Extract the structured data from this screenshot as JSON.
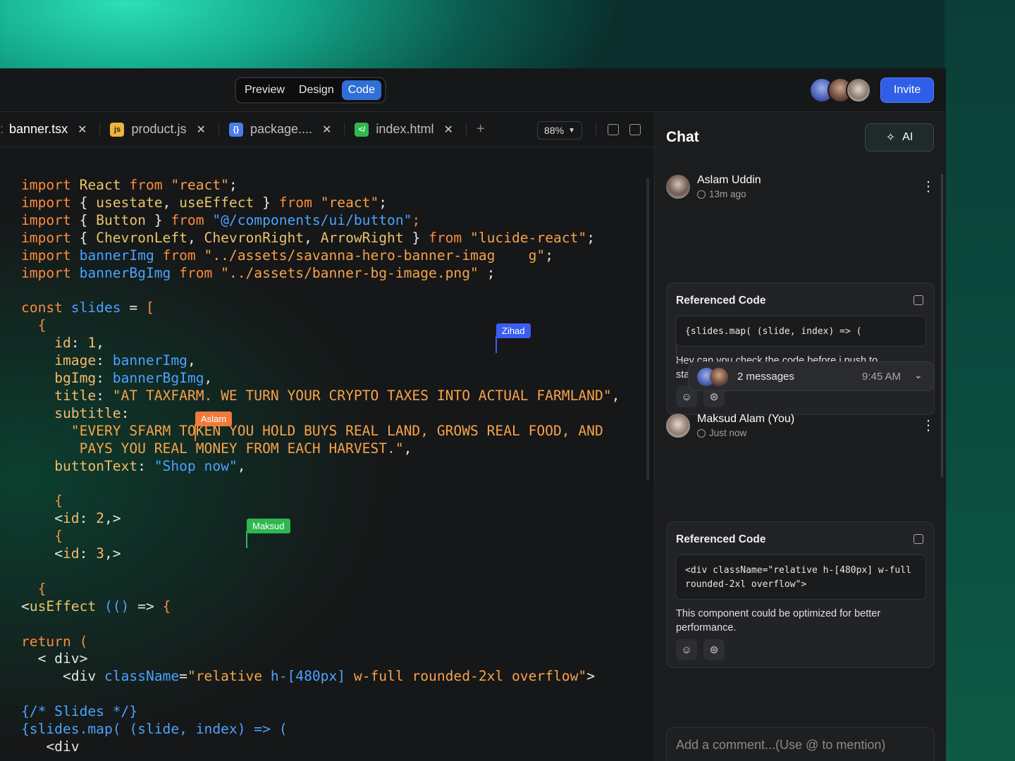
{
  "header": {
    "modes": [
      "Preview",
      "Design",
      "Code"
    ],
    "active_mode": "Code",
    "invite_label": "Invite"
  },
  "editor": {
    "tabs": [
      {
        "label": "banner.tsx",
        "icon": "tsx-file-icon"
      },
      {
        "label": "product.js",
        "icon": "js-file-icon",
        "badge": "js"
      },
      {
        "label": "package....",
        "icon": "json-file-icon",
        "badge": "{}"
      },
      {
        "label": "index.html",
        "icon": "html-file-icon",
        "badge": "</"
      }
    ],
    "zoom": "88%",
    "cursors": [
      {
        "name": "Zihad",
        "color": "#3b5ef0"
      },
      {
        "name": "Aslam",
        "color": "#ef7a3a"
      },
      {
        "name": "Maksud",
        "color": "#2fb84f"
      }
    ]
  },
  "chat": {
    "title": "Chat",
    "ai_label": "AI",
    "messages": [
      {
        "author": "Aslam Uddin",
        "time": "13m ago",
        "card_title": "Referenced Code",
        "code": "{slides.map( (slide, index) => (",
        "text": "Hey can you check the code before i push to staging?",
        "thread": {
          "count_label": "2 messages",
          "time": "9:45 AM"
        }
      },
      {
        "author": "Maksud Alam (You)",
        "time": "Just now",
        "card_title": "Referenced Code",
        "code": "<div className=\"relative h-[480px] w-full rounded-2xl overflow\">",
        "text": "This component could be optimized for better performance."
      }
    ],
    "comment_placeholder": "Add a comment...(Use @ to mention)"
  },
  "colors": {
    "accent_blue": "#2f5ee8",
    "keyword_orange": "#ff8a3c",
    "identifier_blue": "#4aa3ff"
  }
}
